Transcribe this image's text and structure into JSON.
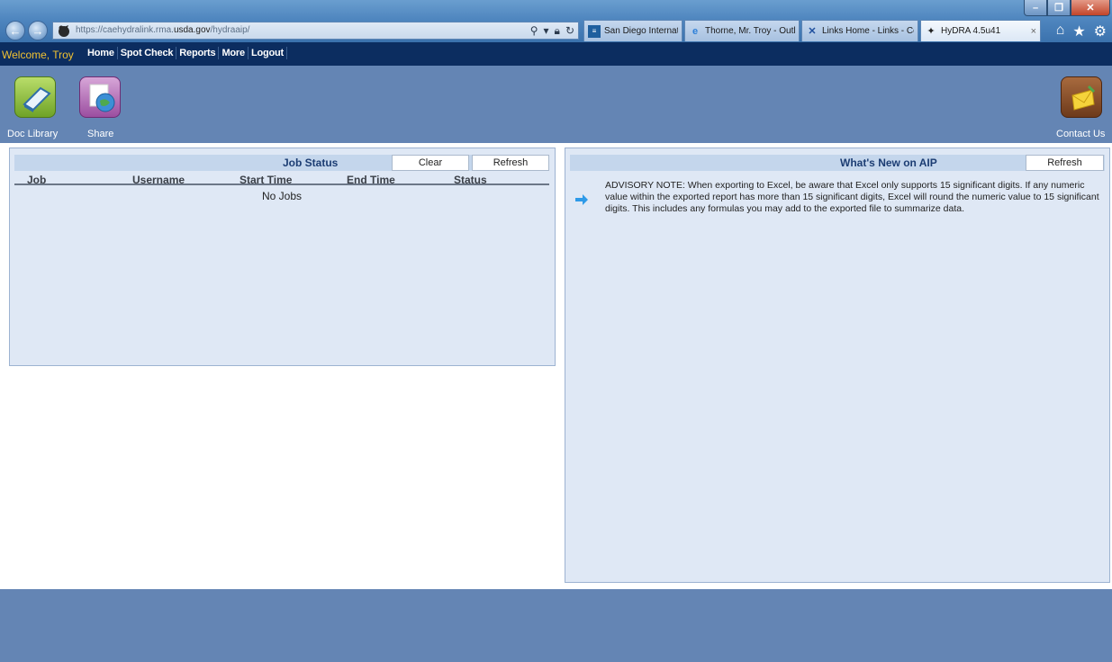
{
  "browser": {
    "url_prefix": "https://caehydralink.rma.",
    "url_host": "usda.gov",
    "url_path": "/hydraaip/",
    "tabs": [
      {
        "label": "San Diego International..."
      },
      {
        "label": "Thorne, Mr. Troy - Outlo..."
      },
      {
        "label": "Links Home - Links - Co..."
      },
      {
        "label": "HyDRA 4.5u41"
      }
    ],
    "close_glyph": "×"
  },
  "appbar": {
    "welcome": "Welcome, Troy",
    "nav": [
      "Home",
      "Spot Check",
      "Reports",
      "More",
      "Logout"
    ]
  },
  "band": {
    "doc_library": "Doc Library",
    "share": "Share",
    "contact_us": "Contact Us"
  },
  "job_status": {
    "title": "Job Status",
    "clear_label": "Clear",
    "refresh_label": "Refresh",
    "columns": [
      "Job",
      "Username",
      "Start Time",
      "End Time",
      "Status"
    ],
    "empty_text": "No Jobs"
  },
  "whats_new": {
    "title": "What's New on AIP",
    "refresh_label": "Refresh",
    "advisory": "ADVISORY NOTE: When exporting to Excel, be aware that Excel only supports 15 significant digits. If any numeric value within the exported report has more than 15 significant digits, Excel will round the numeric value to 15 significant digits. This includes any formulas you may add to the exported file to summarize data."
  },
  "icons": {
    "back": "back-arrow-icon",
    "forward": "forward-arrow-icon",
    "home": "home-icon",
    "favorites": "star-icon",
    "tools": "gear-icon",
    "advisory": "arrow-right-icon"
  },
  "colors": {
    "appbar": "#0c2d60",
    "band": "#6485b4",
    "panel": "#dfe8f5",
    "welcome": "#f1c232"
  }
}
